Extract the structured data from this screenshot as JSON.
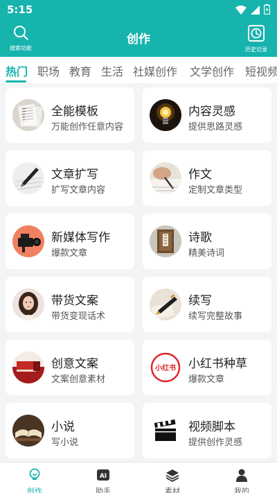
{
  "status": {
    "time": "5:15"
  },
  "header": {
    "title": "创作",
    "search_label": "搜索功能",
    "history_label": "历史记录"
  },
  "tabs": [
    {
      "label": "热门",
      "active": true
    },
    {
      "label": "职场"
    },
    {
      "label": "教育"
    },
    {
      "label": "生活"
    },
    {
      "label": "社媒创作"
    },
    {
      "label": "文学创作"
    },
    {
      "label": "短视频"
    }
  ],
  "cards": [
    {
      "title": "全能模板",
      "subtitle": "万能创作任意内容",
      "icon": "document-template-icon"
    },
    {
      "title": "内容灵感",
      "subtitle": "提供思路灵感",
      "icon": "lightbulb-icon"
    },
    {
      "title": "文章扩写",
      "subtitle": "扩写文章内容",
      "icon": "pen-writing-icon"
    },
    {
      "title": "作文",
      "subtitle": "定制文章类型",
      "icon": "hand-writing-icon"
    },
    {
      "title": "新媒体写作",
      "subtitle": "爆款文章",
      "icon": "video-camera-icon"
    },
    {
      "title": "诗歌",
      "subtitle": "精美诗词",
      "icon": "poetry-book-icon"
    },
    {
      "title": "带货文案",
      "subtitle": "带货变现话术",
      "icon": "influencer-avatar-icon"
    },
    {
      "title": "续写",
      "subtitle": "续写完整故事",
      "icon": "fountain-pen-icon"
    },
    {
      "title": "创意文案",
      "subtitle": "文案创意素材",
      "icon": "red-book-icon"
    },
    {
      "title": "小红书种草",
      "subtitle": "爆款文章",
      "icon": "xiaohongshu-logo-icon",
      "logo_text": "小红书"
    },
    {
      "title": "小说",
      "subtitle": "写小说",
      "icon": "open-book-icon"
    },
    {
      "title": "视频脚本",
      "subtitle": "提供创作灵感",
      "icon": "clapperboard-icon"
    }
  ],
  "bottom_nav": [
    {
      "label": "创作",
      "active": true,
      "icon": "lightbulb-nav-icon"
    },
    {
      "label": "助手",
      "icon": "ai-assistant-icon",
      "badge": "AI"
    },
    {
      "label": "素材",
      "icon": "layers-icon"
    },
    {
      "label": "我的",
      "icon": "person-icon"
    }
  ],
  "colors": {
    "accent": "#17b3ad",
    "background": "#f3f4f6",
    "card": "#ffffff"
  }
}
